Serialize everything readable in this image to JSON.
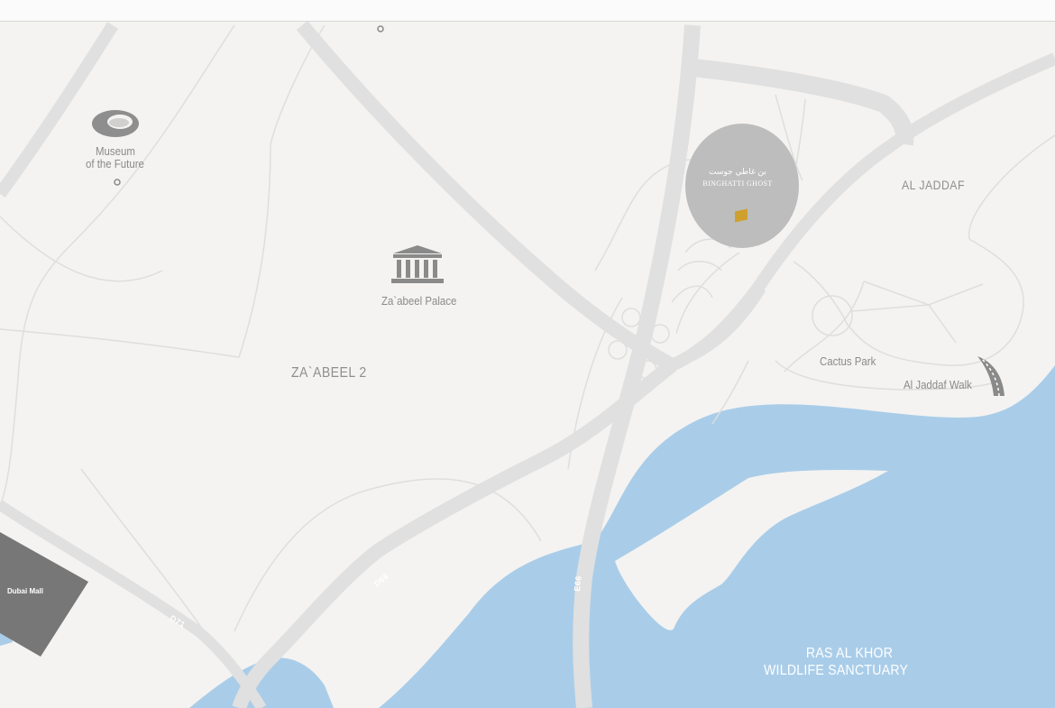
{
  "map": {
    "areas": {
      "zabeel": "ZA`ABEEL 2",
      "al_jaddaf": "AL JADDAF"
    },
    "points_of_interest": {
      "museum_line1": "Museum",
      "museum_line2": "of the Future",
      "palace": "Za`abeel Palace",
      "cactus_park": "Cactus Park",
      "jaddaf_walk": "Al Jaddaf Walk",
      "dubai_mall": "Dubai Mall"
    },
    "water": {
      "line1": "RAS AL KHOR",
      "line2": "WILDLIFE SANCTUARY"
    },
    "roads": {
      "d66": "D66",
      "e66": "E66",
      "d71": "D71"
    },
    "project": {
      "arabic_name": "بن غاطي جوست",
      "name": "BINGHATTI GHOST"
    },
    "icons": [
      "museum-icon",
      "palace-icon",
      "road-walk-icon",
      "project-marker-icon",
      "poi-dot-icon"
    ],
    "colors": {
      "land": "#f4f3f1",
      "road": "#e0e0e0",
      "water": "#a9cde9",
      "mall": "#777777",
      "pin": "#bdbdbd",
      "marker": "#d0a02e"
    }
  }
}
